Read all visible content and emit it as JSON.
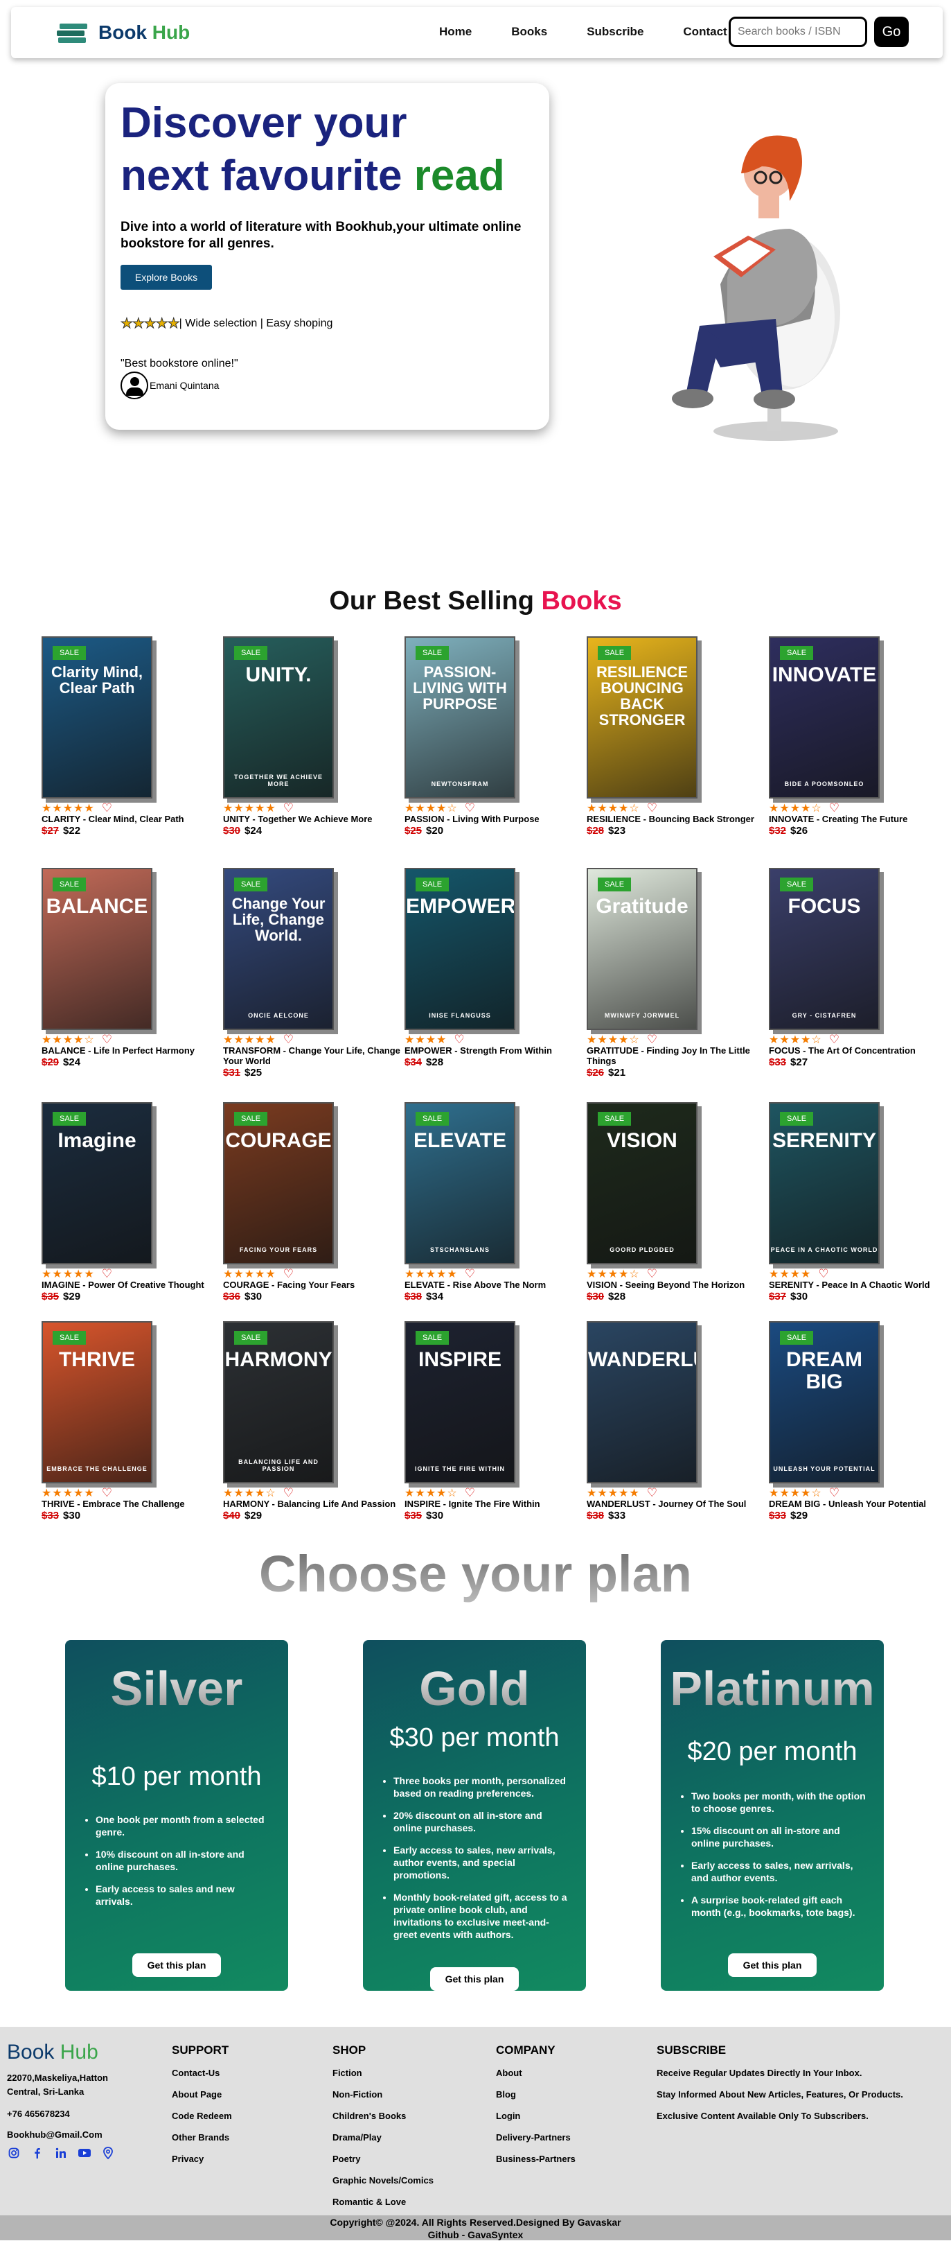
{
  "nav": {
    "brand_book": "Book",
    "brand_hub": "Hub",
    "links": [
      "Home",
      "Books",
      "Subscribe",
      "Contact Us"
    ],
    "search_placeholder": "Search books / ISBN",
    "go_label": "Go"
  },
  "hero": {
    "title_1": "Discover your",
    "title_2a": "next favourite",
    "title_2b": "read",
    "description": "Dive into a world of literature with Bookhub,your ultimate online bookstore for all genres.",
    "cta": "Explore Books",
    "stars": "★★★★★",
    "tagline": "| Wide selection | Easy shoping",
    "quote": "\"Best bookstore online!\"",
    "author": "Emani Quintana"
  },
  "bestselling": {
    "title_prefix": "Our Best Selling",
    "title_accent": "Books",
    "sale_label": "SALE",
    "books": [
      {
        "cover": "Clarity Mind, Clear Path",
        "cover_sub": "",
        "title": "CLARITY - Clear Mind, Clear Path",
        "stars": "★★★★★",
        "rating": 5,
        "old": "$27",
        "price": "$22",
        "bg": "#1c5a86",
        "sale": true
      },
      {
        "cover": "UNITY.",
        "cover_sub": "TOGETHER WE ACHIEVE MORE",
        "title": "UNITY - Together We Achieve More",
        "stars": "★★★★★",
        "rating": 5,
        "old": "$30",
        "price": "$24",
        "bg": "#265e5c",
        "sale": true
      },
      {
        "cover": "PASSION-LIVING WITH PURPOSE",
        "cover_sub": "NEWTONSFRAM",
        "title": "PASSION - Living With Purpose",
        "stars": "★★★★☆",
        "rating": 4.5,
        "old": "$25",
        "price": "$20",
        "bg": "#7fb0bd",
        "sale": true
      },
      {
        "cover": "RESILIENCE BOUNCING BACK STRONGER",
        "cover_sub": "",
        "title": "RESILIENCE - Bouncing Back Stronger",
        "stars": "★★★★☆",
        "rating": 4.5,
        "old": "$28",
        "price": "$23",
        "bg": "#e8b51c",
        "sale": true
      },
      {
        "cover": "INNOVATE",
        "cover_sub": "BIDE A POOMSONLEO",
        "title": "INNOVATE - Creating The Future",
        "stars": "★★★★☆",
        "rating": 4.5,
        "old": "$32",
        "price": "$26",
        "bg": "#2e2e5e",
        "sale": true
      },
      {
        "cover": "BALANCE",
        "cover_sub": "",
        "title": "BALANCE - Life In Perfect Harmony",
        "stars": "★★★★☆",
        "rating": 4.5,
        "old": "$29",
        "price": "$24",
        "bg": "#c26a58",
        "sale": true
      },
      {
        "cover": "Change Your Life, Change World.",
        "cover_sub": "ONCIE AELCONE",
        "title": "TRANSFORM - Change Your Life, Change Your World",
        "stars": "★★★★★",
        "rating": 5,
        "old": "$31",
        "price": "$25",
        "bg": "#344a7e",
        "sale": true
      },
      {
        "cover": "EMPOWER",
        "cover_sub": "INISE FLANGUSS",
        "title": "EMPOWER - Strength From Within",
        "stars": "★★★★",
        "rating": 4,
        "old": "$34",
        "price": "$28",
        "bg": "#15566a",
        "sale": true
      },
      {
        "cover": "Gratitude",
        "cover_sub": "MWINWFY JORWMEL",
        "title": "GRATITUDE - Finding Joy In The Little Things",
        "stars": "★★★★☆",
        "rating": 4.5,
        "old": "$26",
        "price": "$21",
        "bg": "#dfe8dc",
        "sale": true
      },
      {
        "cover": "FOCUS",
        "cover_sub": "GRY - CISTAFREN",
        "title": "FOCUS - The Art Of Concentration",
        "stars": "★★★★☆",
        "rating": 4.5,
        "old": "$33",
        "price": "$27",
        "bg": "#3a3f6a",
        "sale": true
      },
      {
        "cover": "Imagine",
        "cover_sub": "",
        "title": "IMAGINE - Power Of Creative Thought",
        "stars": "★★★★★",
        "rating": 5,
        "old": "$35",
        "price": "$29",
        "bg": "#1b2c3e",
        "sale": true
      },
      {
        "cover": "COURAGE",
        "cover_sub": "FACING YOUR FEARS",
        "title": "COURAGE - Facing Your Fears",
        "stars": "★★★★★",
        "rating": 5,
        "old": "$36",
        "price": "$30",
        "bg": "#7a3b20",
        "sale": true
      },
      {
        "cover": "ELEVATE",
        "cover_sub": "STSCHANSLANS",
        "title": "ELEVATE - Rise Above The Norm",
        "stars": "★★★★★",
        "rating": 5,
        "old": "$38",
        "price": "$34",
        "bg": "#2f6f8e",
        "sale": true
      },
      {
        "cover": "VISION",
        "cover_sub": "GOORD PLDGDED",
        "title": "VISION - Seeing Beyond The Horizon",
        "stars": "★★★★☆",
        "rating": 4.5,
        "old": "$30",
        "price": "$28",
        "bg": "#1e2a1c",
        "sale": true
      },
      {
        "cover": "SERENITY",
        "cover_sub": "PEACE IN A CHAOTIC WORLD",
        "title": "SERENITY - Peace In A Chaotic World",
        "stars": "★★★★",
        "rating": 4,
        "old": "$37",
        "price": "$30",
        "bg": "#1e5561",
        "sale": true
      },
      {
        "cover": "THRIVE",
        "cover_sub": "EMBRACE THE CHALLENGE",
        "title": "THRIVE - Embrace The Challenge",
        "stars": "★★★★★",
        "rating": 5,
        "old": "$33",
        "price": "$30",
        "bg": "#d8552c",
        "sale": true
      },
      {
        "cover": "HARMONY",
        "cover_sub": "BALANCING LIFE AND PASSION",
        "title": "HARMONY - Balancing Life And Passion",
        "stars": "★★★★☆",
        "rating": 4.5,
        "old": "$40",
        "price": "$29",
        "bg": "#2c3034",
        "sale": true
      },
      {
        "cover": "INSPIRE",
        "cover_sub": "IGNITE THE FIRE WITHIN",
        "title": "INSPIRE - Ignite The Fire Within",
        "stars": "★★★★☆",
        "rating": 4.5,
        "old": "$35",
        "price": "$30",
        "bg": "#1d2230",
        "sale": true
      },
      {
        "cover": "WANDERLUST",
        "cover_sub": "",
        "title": "WANDERLUST - Journey Of The Soul",
        "stars": "★★★★★",
        "rating": 5,
        "old": "$38",
        "price": "$33",
        "bg": "#2a4561",
        "sale": false
      },
      {
        "cover": "DREAM BIG",
        "cover_sub": "UNLEASH YOUR POTENTIAL",
        "title": "DREAM BIG - Unleash Your Potential",
        "stars": "★★★★☆",
        "rating": 4.5,
        "old": "$33",
        "price": "$29",
        "bg": "#1a4a80",
        "sale": true
      }
    ]
  },
  "plans": {
    "title": "Choose your plan",
    "items": [
      {
        "name": "Silver",
        "price": "$10 per month",
        "features": [
          "One book per month from a selected genre.",
          "10% discount on all in-store and online purchases.",
          "Early access to sales and new arrivals."
        ],
        "cta": "Get this plan"
      },
      {
        "name": "Gold",
        "price": "$30 per month",
        "features": [
          "Three books per month, personalized based on reading preferences.",
          "20% discount on all in-store and online purchases.",
          "Early access to sales, new arrivals, author events, and special promotions.",
          "Monthly book-related gift, access to a private online book club, and invitations to exclusive meet-and-greet events with authors."
        ],
        "cta": "Get this plan"
      },
      {
        "name": "Platinum",
        "price": "$20 per month",
        "features": [
          "Two books per month, with the option to choose genres.",
          "15% discount on all in-store and online purchases.",
          "Early access to sales, new arrivals, and author events.",
          "A surprise book-related gift each month (e.g., bookmarks, tote bags)."
        ],
        "cta": "Get this plan"
      }
    ]
  },
  "footer": {
    "brand_book": "Book",
    "brand_hub": "Hub",
    "address_1": "22070,Maskeliya,Hatton",
    "address_2": "Central, Sri-Lanka",
    "phone": "+76 465678234",
    "email": "Bookhub@Gmail.Com",
    "support": {
      "title": "SUPPORT",
      "links": [
        "Contact-Us",
        "About Page",
        "Code Redeem",
        "Other Brands",
        "Privacy"
      ]
    },
    "shop": {
      "title": "SHOP",
      "links": [
        "Fiction",
        "Non-Fiction",
        "Children's Books",
        "Drama/Play",
        "Poetry",
        "Graphic Novels/Comics",
        "Romantic & Love"
      ]
    },
    "company": {
      "title": "COMPANY",
      "links": [
        "About",
        "Blog",
        "Login",
        "Delivery-Partners",
        "Business-Partners"
      ]
    },
    "subscribe": {
      "title": "SUBSCRIBE",
      "lines": [
        "Receive Regular Updates Directly In Your Inbox.",
        "Stay Informed About New Articles, Features, Or Products.",
        "Exclusive Content Available Only To Subscribers."
      ]
    },
    "copyright_1": "Copyright© @2024. All Rights Reserved.Designed By Gavaskar",
    "copyright_2": "Github - GavaSyntex"
  }
}
